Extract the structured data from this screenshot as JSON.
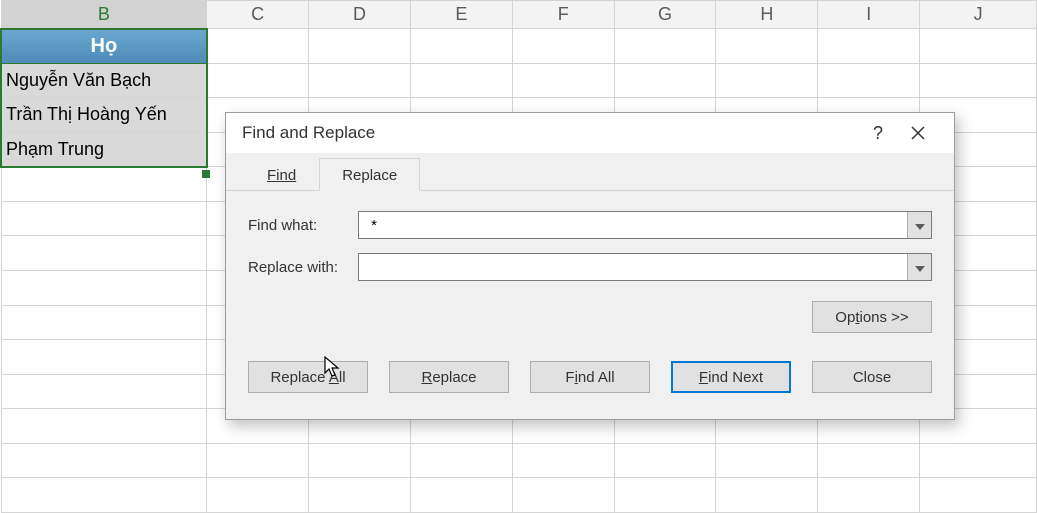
{
  "grid": {
    "columns": [
      "B",
      "C",
      "D",
      "E",
      "F",
      "G",
      "H",
      "I",
      "J"
    ],
    "header_cell": "Họ",
    "rows": [
      "Nguyễn Văn Bạch",
      "Trần Thị Hoàng Yến",
      "Phạm Trung"
    ]
  },
  "dialog": {
    "title": "Find and Replace",
    "help_tooltip": "?",
    "tabs": {
      "find": "Find",
      "replace": "Replace",
      "active": "replace"
    },
    "labels": {
      "find_what": "Find what:",
      "replace_with": "Replace with:"
    },
    "values": {
      "find_what": " *",
      "replace_with": ""
    },
    "buttons": {
      "options": "Options >>",
      "replace_all": "Replace All",
      "replace": "Replace",
      "find_all": "Find All",
      "find_next": "Find Next",
      "close": "Close"
    }
  }
}
